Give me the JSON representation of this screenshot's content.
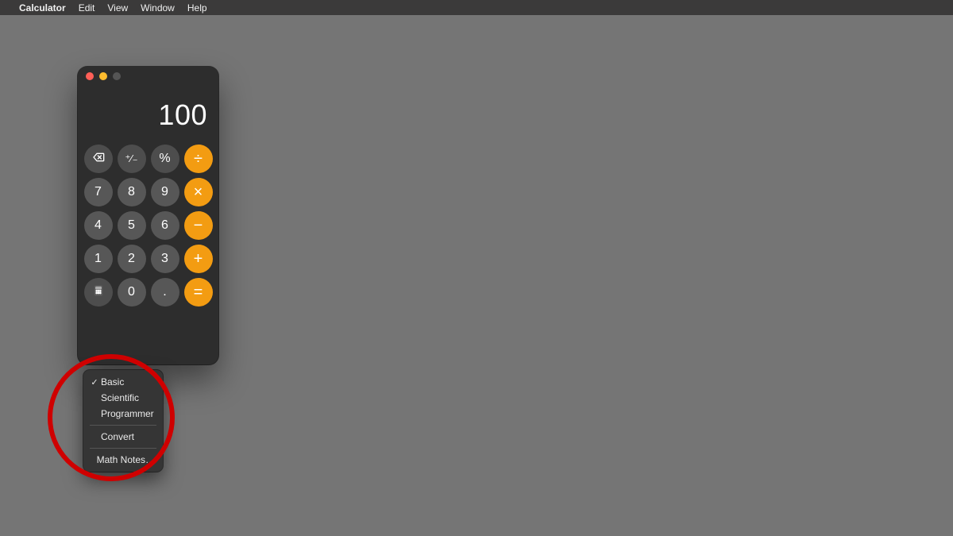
{
  "menubar": {
    "items": [
      "Calculator",
      "Edit",
      "View",
      "Window",
      "Help"
    ]
  },
  "calculator": {
    "display_value": "100",
    "keys": {
      "delete_name": "delete-icon",
      "sign": "⁺∕₋",
      "percent": "%",
      "divide": "÷",
      "seven": "7",
      "eight": "8",
      "nine": "9",
      "multiply": "×",
      "four": "4",
      "five": "5",
      "six": "6",
      "minus": "−",
      "one": "1",
      "two": "2",
      "three": "3",
      "plus": "+",
      "mode_name": "calculator-mode-icon",
      "zero": "0",
      "decimal": ".",
      "equals": "="
    }
  },
  "popup_menu": {
    "items": [
      {
        "label": "Basic",
        "checked": true
      },
      {
        "label": "Scientific",
        "checked": false
      },
      {
        "label": "Programmer",
        "checked": false
      }
    ],
    "convert": "Convert",
    "math_notes": "Math Notes…"
  },
  "colors": {
    "accent": "#f39c12",
    "annotation": "#cf0000"
  }
}
